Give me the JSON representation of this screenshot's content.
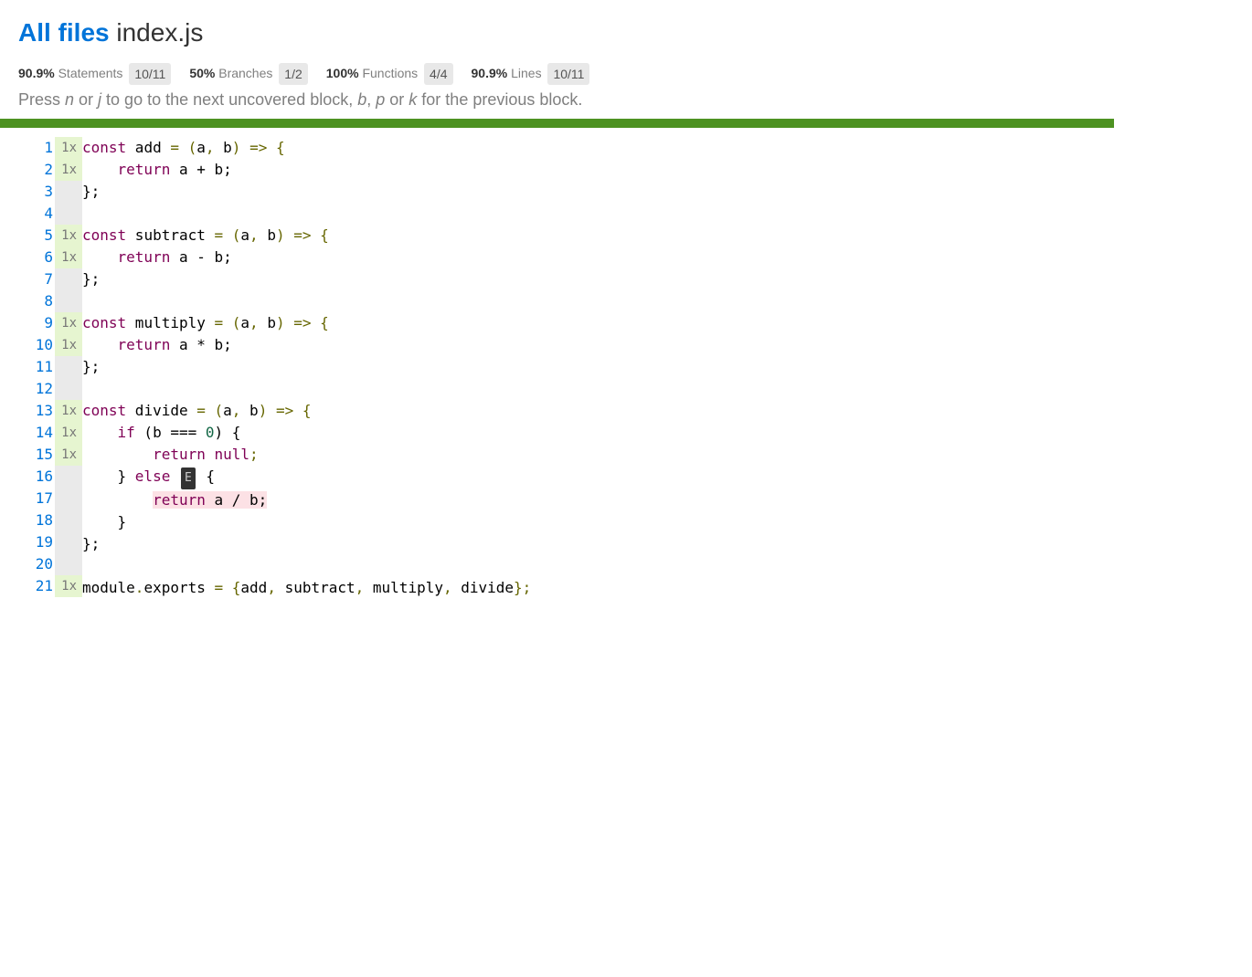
{
  "breadcrumb": {
    "root_label": "All files",
    "file_label": "index.js"
  },
  "summary": {
    "statements": {
      "pct": "90.9%",
      "label": "Statements",
      "fraction": "10/11"
    },
    "branches": {
      "pct": "50%",
      "label": "Branches",
      "fraction": "1/2"
    },
    "functions": {
      "pct": "100%",
      "label": "Functions",
      "fraction": "4/4"
    },
    "lines": {
      "pct": "90.9%",
      "label": "Lines",
      "fraction": "10/11"
    }
  },
  "hint": {
    "full": "Press n or j to go to the next uncovered block, b, p or k for the previous block."
  },
  "lines": [
    {
      "n": "1",
      "cov": "1x",
      "cls": "cline-yes"
    },
    {
      "n": "2",
      "cov": "1x",
      "cls": "cline-yes"
    },
    {
      "n": "3",
      "cov": " ",
      "cls": "cline-neutral"
    },
    {
      "n": "4",
      "cov": " ",
      "cls": "cline-neutral"
    },
    {
      "n": "5",
      "cov": "1x",
      "cls": "cline-yes"
    },
    {
      "n": "6",
      "cov": "1x",
      "cls": "cline-yes"
    },
    {
      "n": "7",
      "cov": " ",
      "cls": "cline-neutral"
    },
    {
      "n": "8",
      "cov": " ",
      "cls": "cline-neutral"
    },
    {
      "n": "9",
      "cov": "1x",
      "cls": "cline-yes"
    },
    {
      "n": "10",
      "cov": "1x",
      "cls": "cline-yes"
    },
    {
      "n": "11",
      "cov": " ",
      "cls": "cline-neutral"
    },
    {
      "n": "12",
      "cov": " ",
      "cls": "cline-neutral"
    },
    {
      "n": "13",
      "cov": "1x",
      "cls": "cline-yes"
    },
    {
      "n": "14",
      "cov": "1x",
      "cls": "cline-yes"
    },
    {
      "n": "15",
      "cov": "1x",
      "cls": "cline-yes"
    },
    {
      "n": "16",
      "cov": " ",
      "cls": "cline-neutral"
    },
    {
      "n": "17",
      "cov": " ",
      "cls": "cline-neutral"
    },
    {
      "n": "18",
      "cov": " ",
      "cls": "cline-neutral"
    },
    {
      "n": "19",
      "cov": " ",
      "cls": "cline-neutral"
    },
    {
      "n": "20",
      "cov": " ",
      "cls": "cline-neutral"
    },
    {
      "n": "21",
      "cov": "1x",
      "cls": "cline-yes"
    }
  ],
  "code": {
    "l1": {
      "kw1": "const",
      "id": " add ",
      "op": "= (",
      "a": "a",
      "c1": ", ",
      "b": "b",
      "op2": ") => {"
    },
    "l2": {
      "ind": "    ",
      "kw": "return",
      "expr": " a + b;"
    },
    "l3": {
      "txt": "};"
    },
    "l4": {
      "txt": " "
    },
    "l5": {
      "kw1": "const",
      "id": " subtract ",
      "op": "= (",
      "a": "a",
      "c1": ", ",
      "b": "b",
      "op2": ") => {"
    },
    "l6": {
      "ind": "    ",
      "kw": "return",
      "expr": " a - b;"
    },
    "l7": {
      "txt": "};"
    },
    "l8": {
      "txt": " "
    },
    "l9": {
      "kw1": "const",
      "id": " multiply ",
      "op": "= (",
      "a": "a",
      "c1": ", ",
      "b": "b",
      "op2": ") => {"
    },
    "l10": {
      "ind": "    ",
      "kw": "return",
      "expr": " a * b;"
    },
    "l11": {
      "txt": "};"
    },
    "l12": {
      "txt": " "
    },
    "l13": {
      "kw1": "const",
      "id": " divide ",
      "op": "= (",
      "a": "a",
      "c1": ", ",
      "b": "b",
      "op2": ") => {"
    },
    "l14": {
      "ind": "    ",
      "kw": "if",
      "expr": " (b === ",
      "zero": "0",
      "close": ") {"
    },
    "l15": {
      "ind": "        ",
      "kw": "return",
      "sp": " ",
      "null": "null",
      "semi": ";"
    },
    "l16": {
      "ind": "    ",
      "close": "} ",
      "kw": "else",
      "badge": "E",
      "open": " {"
    },
    "l17": {
      "ind": "        ",
      "kw": "return",
      "expr": " a / b;"
    },
    "l18": {
      "ind": "    ",
      "txt": "}"
    },
    "l19": {
      "txt": "};"
    },
    "l20": {
      "txt": " "
    },
    "l21": {
      "mod": "module",
      "dot": ".",
      "exp": "exports ",
      "eq": "= {",
      "a": "add",
      "c1": ", ",
      "s": "subtract",
      "c2": ", ",
      "m": "multiply",
      "c3": ", ",
      "d": "divide",
      "close": "};"
    }
  }
}
